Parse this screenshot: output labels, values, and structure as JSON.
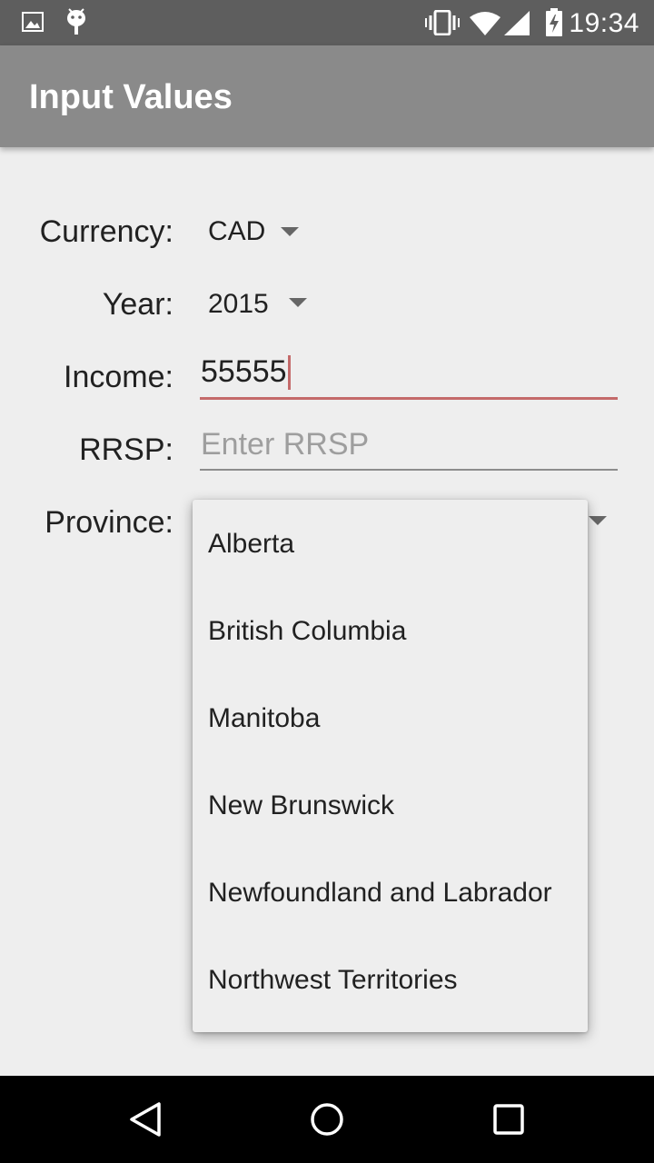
{
  "status_bar": {
    "time": "19:34",
    "icons": [
      "image-icon",
      "android-debug-icon",
      "vibrate-icon",
      "wifi-icon",
      "cell-signal-icon",
      "battery-charging-icon"
    ]
  },
  "app_bar": {
    "title": "Input Values",
    "background": "#8a8a8a"
  },
  "form": {
    "currency": {
      "label": "Currency:",
      "value": "CAD"
    },
    "year": {
      "label": "Year:",
      "value": "2015"
    },
    "income": {
      "label": "Income:",
      "value": "55555"
    },
    "rrsp": {
      "label": "RRSP:",
      "value": "",
      "placeholder": "Enter RRSP"
    },
    "province": {
      "label": "Province:"
    }
  },
  "province_dropdown": {
    "options": [
      "Alberta",
      "British Columbia",
      "Manitoba",
      "New Brunswick",
      "Newfoundland and Labrador",
      "Northwest Territories"
    ]
  },
  "nav_bar": {
    "buttons": [
      "back-icon",
      "home-icon",
      "recents-icon"
    ]
  },
  "colors": {
    "accent": "#c46a6a",
    "status_bar": "#5e5e5e",
    "background": "#eeeeee"
  }
}
